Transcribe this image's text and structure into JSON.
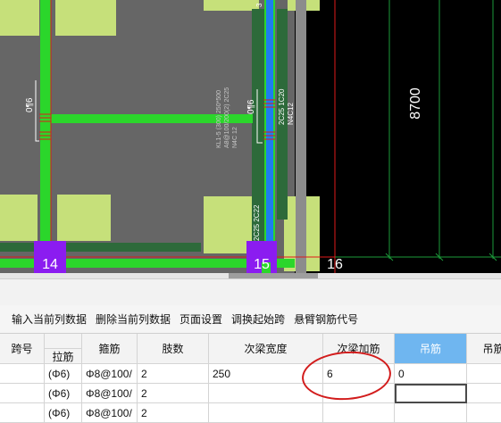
{
  "drawing": {
    "axis_labels": [
      "14",
      "15",
      "16"
    ],
    "dimension": "8700",
    "beam_note_1": "0¶6",
    "beam_note_2": "0¶6",
    "beam_note_3": "3",
    "beam_text_vertical_a": "KL1-5 (300) 250*500",
    "beam_text_vertical_b": "A8@100/200(2) 2C25",
    "beam_text_vertical_c": "N4C 12",
    "beam_text_vertical_d": "2C25 1C20",
    "beam_text_vertical_e": "N4C12",
    "beam_text_vertical_f": "2C25 2C22"
  },
  "toolbar": {
    "insert_row": "输入当前列数据",
    "delete_row": "删除当前列数据",
    "page_setup": "页面设置",
    "adjust_span": "调换起始跨",
    "cantilever_code": "悬臂钢筋代号"
  },
  "table": {
    "headers": {
      "span_no": "跨号",
      "tie_bar": "拉筋",
      "stirrup": "箍筋",
      "legs": "肢数",
      "sub_beam_width": "次梁宽度",
      "sub_beam_extra": "次梁加筋",
      "hanger": "吊筋",
      "hanger_anchor": "吊筋"
    },
    "rows": [
      {
        "tie": "(Φ6)",
        "stirrup": "Φ8@100/",
        "legs": "2",
        "width": "250",
        "extra": "6",
        "hanger": "0"
      },
      {
        "tie": "(Φ6)",
        "stirrup": "Φ8@100/",
        "legs": "2",
        "width": "",
        "extra": "",
        "hanger": ""
      },
      {
        "tie": "(Φ6)",
        "stirrup": "Φ8@100/",
        "legs": "2",
        "width": "",
        "extra": "",
        "hanger": ""
      }
    ]
  },
  "colors": {
    "green_beam": "#2bd62b",
    "yellow_green": "#c6e07a",
    "dark_gray": "#666666",
    "dark_green": "#2d6a3a",
    "blue_beam": "#1e7df0",
    "purple_axis": "#8b1cf0",
    "red_line": "#e01a1a",
    "annotation": "#d21c1c"
  }
}
